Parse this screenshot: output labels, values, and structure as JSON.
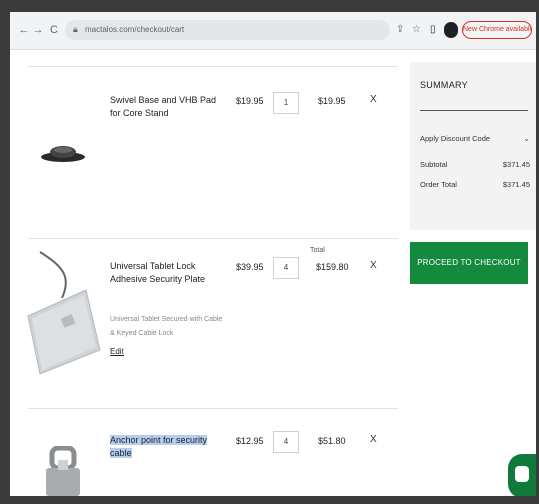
{
  "browser": {
    "url": "mactalos.com/checkout/cart",
    "update_label": "New Chrome available",
    "nav_back": "←",
    "nav_forward": "→",
    "nav_reload": "C"
  },
  "cart": {
    "items": [
      {
        "name": "Swivel Base and VHB Pad for Core Stand",
        "price": "$19.95",
        "quantity": "1",
        "total": "$19.95",
        "remove": "X"
      },
      {
        "name": "Universal Tablet Lock Adhesive Security Plate",
        "price": "$39.95",
        "quantity": "4",
        "total_label": "Total",
        "total": "$159.80",
        "remove": "X",
        "options": [
          "Universal Tablet Secured with Cable",
          "& Keyed Cable Lock"
        ],
        "edit_label": "Edit"
      },
      {
        "name": "Anchor point for security cable",
        "price": "$12.95",
        "quantity": "4",
        "total": "$51.80",
        "remove": "X"
      }
    ]
  },
  "summary": {
    "title": "SUMMARY",
    "discount_label": "Apply Discount Code",
    "subtotal_label": "Subtotal",
    "subtotal_value": "$371.45",
    "order_total_label": "Order Total",
    "order_total_value": "$371.45",
    "checkout_label": "PROCEED TO CHECKOUT"
  },
  "colors": {
    "checkout": "#138a3e",
    "chat": "#0f7a3a",
    "update": "#d93025"
  }
}
